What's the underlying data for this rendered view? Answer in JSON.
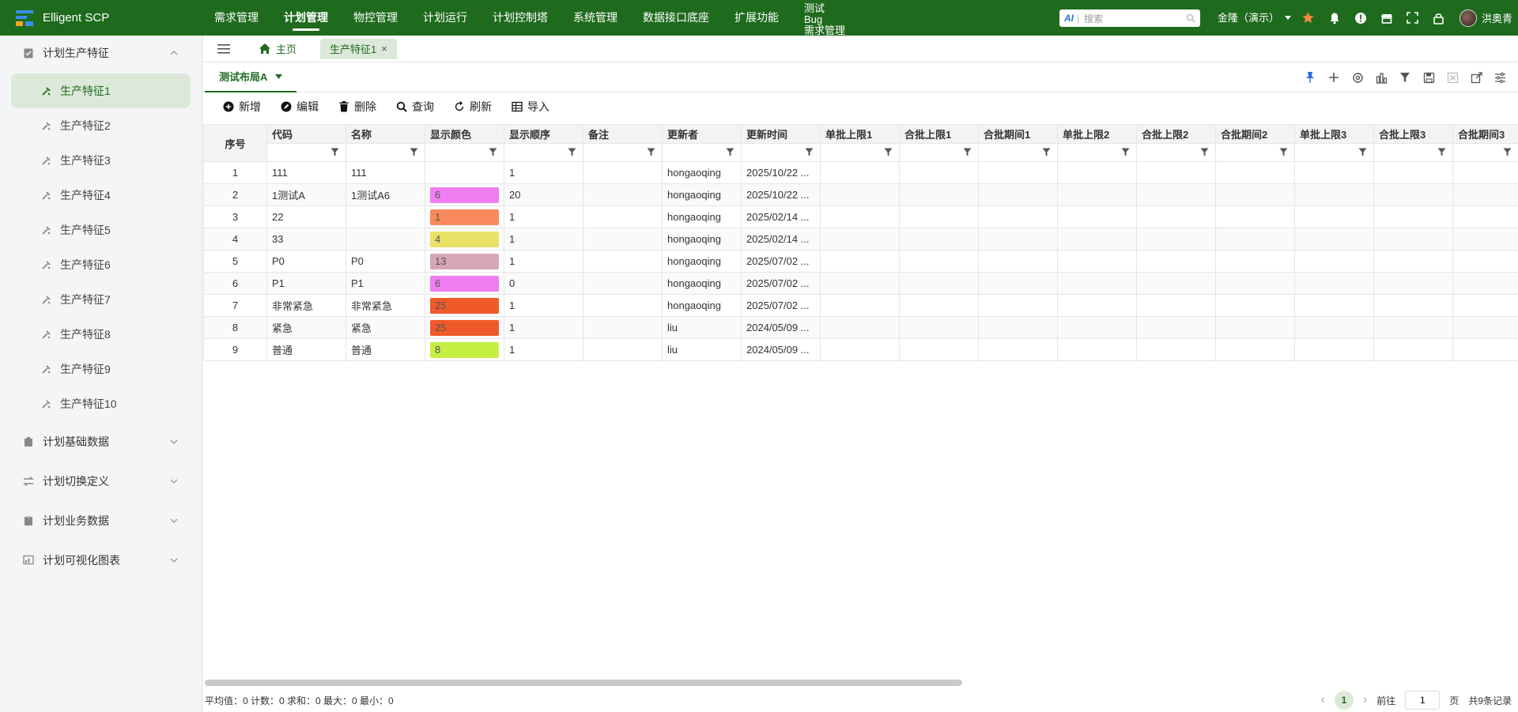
{
  "app": {
    "title": "Elligent SCP",
    "brand_color": "#1f6b1e",
    "accent_light": "#dce8d9"
  },
  "nav": {
    "items": [
      "需求管理",
      "计划管理",
      "物控管理",
      "计划运行",
      "计划控制塔",
      "系统管理",
      "数据接口底座",
      "扩展功能"
    ],
    "active": "计划管理",
    "stacked": [
      "测试",
      "Bug",
      "需求管理"
    ]
  },
  "search": {
    "placeholder": "搜索",
    "ai_label": "AI"
  },
  "tenant": {
    "label": "金隆（演示）"
  },
  "user": {
    "name": "洪奥青"
  },
  "sidebar": {
    "group_top": {
      "label": "计划生产特征"
    },
    "items": [
      "生产特征1",
      "生产特征2",
      "生产特征3",
      "生产特征4",
      "生产特征5",
      "生产特征6",
      "生产特征7",
      "生产特征8",
      "生产特征9",
      "生产特征10"
    ],
    "groups": [
      "计划基础数据",
      "计划切换定义",
      "计划业务数据",
      "计划可视化图表"
    ]
  },
  "tabs": {
    "home": "主页",
    "current": "生产特征1"
  },
  "layout": {
    "name": "测试布局A"
  },
  "toolbar": {
    "add": "新增",
    "edit": "编辑",
    "delete": "删除",
    "query": "查询",
    "refresh": "刷新",
    "import": "导入"
  },
  "table": {
    "seq_header": "序号",
    "columns": [
      "代码",
      "名称",
      "显示颜色",
      "显示顺序",
      "备注",
      "更新者",
      "更新时间",
      "单批上限1",
      "合批上限1",
      "合批期间1",
      "单批上限2",
      "合批上限2",
      "合批期间2",
      "单批上限3",
      "合批上限3",
      "合批期间3"
    ],
    "rows": [
      {
        "seq": "1",
        "code": "111",
        "name": "111",
        "color_val": "",
        "color": "",
        "order": "1",
        "note": "",
        "updater": "hongaoqing",
        "time": "2025/10/22 ..."
      },
      {
        "seq": "2",
        "code": "1测试A",
        "name": "1测试A6",
        "color_val": "6",
        "color": "#f07ef0",
        "order": "20",
        "note": "",
        "updater": "hongaoqing",
        "time": "2025/10/22 ..."
      },
      {
        "seq": "3",
        "code": "22",
        "name": "",
        "color_val": "1",
        "color": "#fa8a5e",
        "order": "1",
        "note": "",
        "updater": "hongaoqing",
        "time": "2025/02/14 ..."
      },
      {
        "seq": "4",
        "code": "33",
        "name": "",
        "color_val": "4",
        "color": "#e8e266",
        "order": "1",
        "note": "",
        "updater": "hongaoqing",
        "time": "2025/02/14 ..."
      },
      {
        "seq": "5",
        "code": "P0",
        "name": "P0",
        "color_val": "13",
        "color": "#d6a6b8",
        "order": "1",
        "note": "",
        "updater": "hongaoqing",
        "time": "2025/07/02 ..."
      },
      {
        "seq": "6",
        "code": "P1",
        "name": "P1",
        "color_val": "6",
        "color": "#f07ef0",
        "order": "0",
        "note": "",
        "updater": "hongaoqing",
        "time": "2025/07/02 ..."
      },
      {
        "seq": "7",
        "code": "非常紧急",
        "name": "非常紧急",
        "color_val": "25",
        "color": "#f05a2a",
        "order": "1",
        "note": "",
        "updater": "hongaoqing",
        "time": "2025/07/02 ..."
      },
      {
        "seq": "8",
        "code": "紧急",
        "name": "紧急",
        "color_val": "25",
        "color": "#f05a2a",
        "order": "1",
        "note": "",
        "updater": "liu",
        "time": "2024/05/09 ..."
      },
      {
        "seq": "9",
        "code": "普通",
        "name": "普通",
        "color_val": "8",
        "color": "#c6ef44",
        "order": "1",
        "note": "",
        "updater": "liu",
        "time": "2024/05/09 ..."
      }
    ]
  },
  "footer": {
    "stats": "平均值：0 计数：0 求和：0 最大：0 最小：0",
    "current_page": "1",
    "goto_label": "前往",
    "goto_value": "1",
    "page_suffix": "页",
    "total": "共9条记录"
  }
}
